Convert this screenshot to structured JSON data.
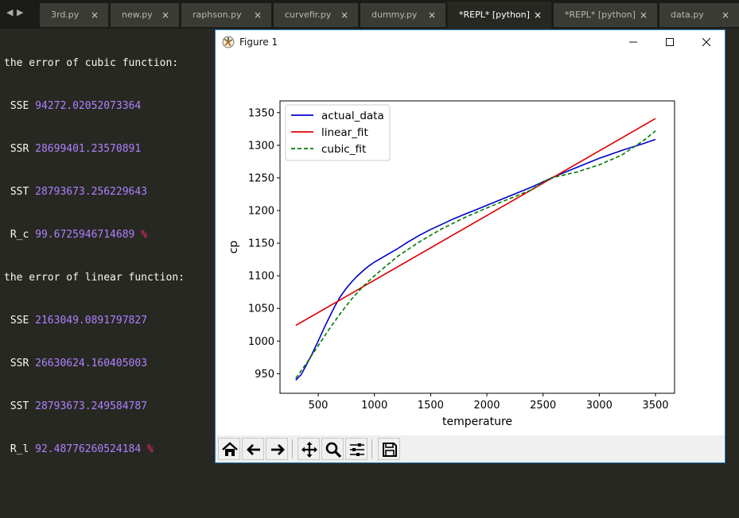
{
  "tabs": [
    {
      "label": "3rd.py",
      "active": false
    },
    {
      "label": "new.py",
      "active": false
    },
    {
      "label": "raphson.py",
      "active": false
    },
    {
      "label": "curvefir.py",
      "active": false
    },
    {
      "label": "dummy.py",
      "active": false
    },
    {
      "label": "*REPL* [python]",
      "active": true
    },
    {
      "label": "*REPL* [python]",
      "active": false
    },
    {
      "label": "data.py",
      "active": false
    }
  ],
  "tab_close_glyph": "×",
  "repl": {
    "cubic_header": "the error of cubic function:",
    "cubic": [
      {
        "key": "SSE",
        "value": "94272.02052073364",
        "suffix": ""
      },
      {
        "key": "SSR",
        "value": "28699401.23570891",
        "suffix": ""
      },
      {
        "key": "SST",
        "value": "28793673.256229643",
        "suffix": ""
      },
      {
        "key": "R_c",
        "value": "99.6725946714689",
        "suffix": "%"
      }
    ],
    "linear_header": "the error of linear function:",
    "linear": [
      {
        "key": "SSE",
        "value": "2163049.0891797827",
        "suffix": ""
      },
      {
        "key": "SSR",
        "value": "26630624.160405003",
        "suffix": ""
      },
      {
        "key": "SST",
        "value": "28793673.249584787",
        "suffix": ""
      },
      {
        "key": "R_l",
        "value": "92.48776260524184",
        "suffix": "%"
      }
    ]
  },
  "figure_window": {
    "title": "Figure 1"
  },
  "toolbar_icons": [
    "home-icon",
    "back-arrow-icon",
    "forward-arrow-icon",
    "pan-icon",
    "zoom-icon",
    "configure-subplots-icon",
    "save-icon"
  ],
  "colors": {
    "editor_bg": "#272822",
    "number": "#ae81ff",
    "percent": "#f92672",
    "actual": "#0000cc",
    "linear": "#dd0000",
    "cubic": "#007a00"
  },
  "chart_data": {
    "type": "line",
    "xlabel": "temperature",
    "ylabel": "cp",
    "xlim": [
      160,
      3670
    ],
    "ylim": [
      920,
      1368
    ],
    "xticks": [
      500,
      1000,
      1500,
      2000,
      2500,
      3000,
      3500
    ],
    "yticks": [
      950,
      1000,
      1050,
      1100,
      1150,
      1200,
      1250,
      1300,
      1350
    ],
    "legend_position": "top-left",
    "series": [
      {
        "name": "actual_data",
        "style": "solid",
        "color": "#0000cc",
        "x": [
          300,
          350,
          400,
          450,
          500,
          550,
          600,
          650,
          700,
          750,
          800,
          850,
          900,
          950,
          1000,
          1100,
          1200,
          1300,
          1400,
          1500,
          1600,
          1700,
          1800,
          1900,
          2000,
          2200,
          2400,
          2500,
          2600,
          2800,
          3000,
          3200,
          3400,
          3500
        ],
        "y": [
          940,
          949,
          965,
          982,
          1000,
          1019,
          1037,
          1054,
          1069,
          1081,
          1091,
          1100,
          1108,
          1115,
          1121,
          1131,
          1141,
          1152,
          1162,
          1171,
          1179,
          1187,
          1194,
          1201,
          1208,
          1222,
          1236,
          1244,
          1252,
          1266,
          1280,
          1292,
          1303,
          1309
        ]
      },
      {
        "name": "linear_fit",
        "style": "solid",
        "color": "#dd0000",
        "x": [
          300,
          3500
        ],
        "y": [
          1024,
          1341
        ]
      },
      {
        "name": "cubic_fit",
        "style": "dashed",
        "color": "#007a00",
        "x": [
          300,
          400,
          500,
          600,
          700,
          800,
          900,
          1000,
          1200,
          1400,
          1600,
          1800,
          2000,
          2200,
          2400,
          2500,
          2600,
          2800,
          3000,
          3200,
          3400,
          3500
        ],
        "y": [
          943,
          967,
          993,
          1019,
          1043,
          1065,
          1084,
          1100,
          1129,
          1152,
          1172,
          1189,
          1204,
          1218,
          1232,
          1244,
          1251,
          1259,
          1270,
          1285,
          1308,
          1322
        ]
      }
    ]
  }
}
